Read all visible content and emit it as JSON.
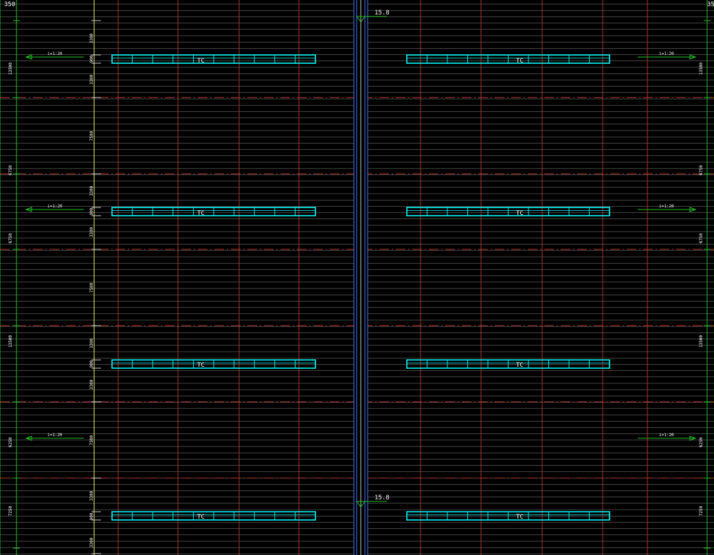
{
  "drawing": {
    "corner_labels": {
      "top_left": "350",
      "top_right": "35"
    },
    "elevation_label": "15.8",
    "trench_label": "TC",
    "slope_labels": [
      "i=1:20",
      "i=1:20",
      "i=1:20",
      "i=1:20",
      "i=1:20",
      "i=1:20"
    ],
    "left_dimensions": [
      "13500",
      "6750",
      "6750",
      "13500",
      "6250",
      "7250"
    ],
    "right_dimensions": [
      "13500",
      "6750",
      "6750",
      "13500",
      "6250",
      "7250"
    ],
    "inner_dimensions": [
      "3300",
      "900",
      "3300",
      "7500",
      "3300",
      "900",
      "3300",
      "7500",
      "3300",
      "900",
      "3300",
      "7500",
      "3300",
      "900",
      "3300"
    ],
    "colors": {
      "background": "#000000",
      "minor_lines": "#ffffff",
      "grid_red": "#c0392b",
      "trench": "#00ffff",
      "green": "#22c522",
      "yellow": "#f5f56a",
      "channel": "#4a78ff"
    }
  }
}
